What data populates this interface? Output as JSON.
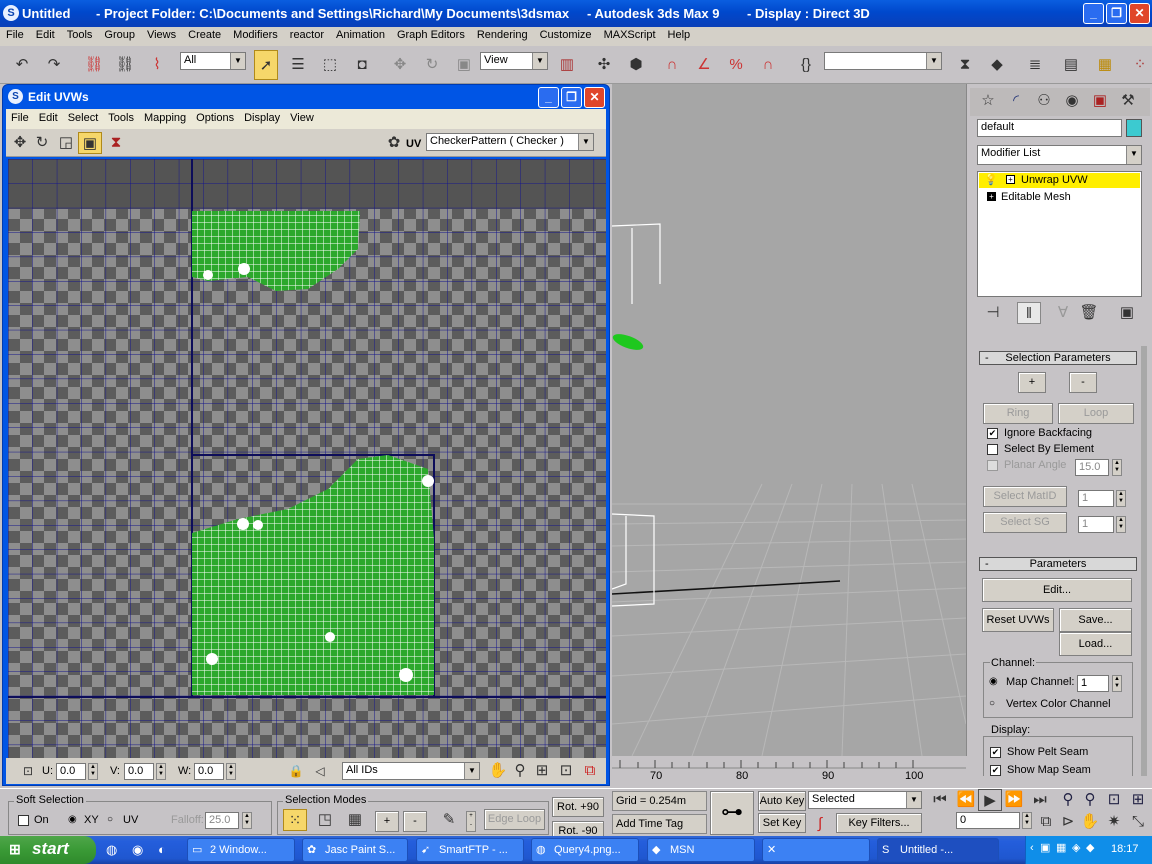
{
  "window": {
    "doc_title": "Untitled",
    "project_folder": "- Project Folder: C:\\Documents and Settings\\Richard\\My Documents\\3dsmax",
    "app_name": "- Autodesk 3ds Max 9",
    "display": "- Display : Direct 3D"
  },
  "menu": [
    "File",
    "Edit",
    "Tools",
    "Group",
    "Views",
    "Create",
    "Modifiers",
    "reactor",
    "Animation",
    "Graph Editors",
    "Rendering",
    "Customize",
    "MAXScript",
    "Help"
  ],
  "toolbar": {
    "selection_filter": "All",
    "ref_coord": "View",
    "named_selection": ""
  },
  "uv_editor": {
    "title": "Edit UVWs",
    "menu": [
      "File",
      "Edit",
      "Select",
      "Tools",
      "Mapping",
      "Options",
      "Display",
      "View"
    ],
    "uv_label": "UV",
    "texture": "CheckerPattern  ( Checker )",
    "u_label": "U:",
    "u_value": "0.0",
    "v_label": "V:",
    "v_value": "0.0",
    "w_label": "W:",
    "w_value": "0.0",
    "ids": "All IDs"
  },
  "command_panel": {
    "object_name": "default",
    "object_color": "#3ccad0",
    "modifier_list": "Modifier List",
    "stack": [
      {
        "label": "Unwrap UVW",
        "selected": true
      },
      {
        "label": "Editable Mesh",
        "selected": false
      }
    ],
    "selection_params": {
      "header": "Selection Parameters",
      "plus": "+",
      "minus": "-",
      "ring": "Ring",
      "loop": "Loop",
      "ignore_backfacing": "Ignore Backfacing",
      "select_by_element": "Select By Element",
      "planar_angle": "Planar Angle",
      "planar_angle_value": "15.0",
      "select_matid": "Select MatID",
      "matid_value": "1",
      "select_sg": "Select SG",
      "sg_value": "1"
    },
    "parameters": {
      "header": "Parameters",
      "edit": "Edit...",
      "reset_uvws": "Reset UVWs",
      "save": "Save...",
      "load": "Load...",
      "channel_label": "Channel:",
      "map_channel": "Map Channel:",
      "map_channel_value": "1",
      "vertex_color_channel": "Vertex Color Channel",
      "display_label": "Display:",
      "show_pelt_seam": "Show Pelt Seam",
      "show_map_seam": "Show Map Seam"
    }
  },
  "trackbar": {
    "ticks": [
      "70",
      "80",
      "90",
      "100"
    ]
  },
  "status": {
    "soft_selection": "Soft Selection",
    "on": "On",
    "xy": "XY",
    "uv": "UV",
    "falloff_label": "Falloff:",
    "falloff_value": "25.0",
    "selection_modes": "Selection Modes",
    "plus": "+",
    "minus": "-",
    "edge_loop": "Edge Loop",
    "rot_plus": "Rot. +90",
    "rot_minus": "Rot. -90",
    "grid": "Grid = 0.254m",
    "add_time_tag": "Add Time Tag",
    "auto_key": "Auto Key",
    "set_key": "Set Key",
    "key_mode": "Selected",
    "key_filters": "Key Filters...",
    "frame": "0"
  },
  "taskbar": {
    "start": "start",
    "tasks": [
      {
        "label": "2 Window..."
      },
      {
        "label": "Jasc Paint S..."
      },
      {
        "label": "SmartFTP - ..."
      },
      {
        "label": "Query4.png..."
      },
      {
        "label": "MSN"
      },
      {
        "label": ""
      },
      {
        "label": "Untitled       -..."
      }
    ],
    "clock": "18:17"
  }
}
